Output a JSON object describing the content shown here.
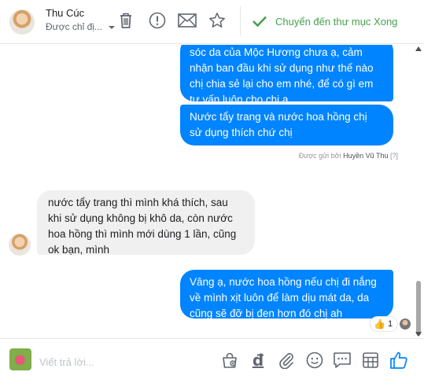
{
  "header": {
    "user_name": "Thu Cúc",
    "assignee_placeholder": "Được chỉ đị...",
    "move_done_label": "Chuyển đến thư mục Xong",
    "icons": [
      "trash-icon",
      "alert-icon",
      "mail-icon",
      "star-icon",
      "checkmark-icon"
    ],
    "accent_color": "#44a24a"
  },
  "messages": [
    {
      "direction": "outgoing",
      "lines": [
        "sóc da của Mộc Hương chưa ạ, cảm",
        "nhận ban đầu khi sử dụng như thế nào",
        "chị chia sẻ lại cho em nhé, để có gì em",
        "tư vấn luôn cho chị ạ"
      ]
    },
    {
      "direction": "outgoing",
      "lines": [
        "Nước tẩy trang và nước hoa hồng chị",
        "sử dụng thích chứ chị"
      ]
    },
    {
      "direction": "incoming",
      "lines": [
        "nước tẩy trang thì mình khá thích, sau",
        "khi sử dụng không bị khô da, còn nước",
        "hoa hồng thì mình mới dùng 1 lần, cũng",
        "ok bạn, mình"
      ]
    },
    {
      "direction": "outgoing",
      "lines": [
        "Vâng ạ, nước hoa hồng nếu chị đi nắng",
        "về mình xịt luôn để làm dịu mát da, da",
        "cũng sẽ đỡ bị đen hơn đó chị ah"
      ]
    }
  ],
  "sent_by": {
    "prefix": "Được gửi bởi",
    "name": "Huyền Vũ Thu",
    "help": "[?]"
  },
  "reaction": {
    "emoji": "👍",
    "count": "1"
  },
  "colors": {
    "outgoing_bubble": "#0084ff",
    "incoming_bubble": "#f1f0f0",
    "like_blue": "#0084ff"
  },
  "composer": {
    "placeholder": "Viết trả lời...",
    "currency_symbol": "đ",
    "icons": [
      "shopping-bag-icon",
      "currency-icon",
      "paperclip-icon",
      "emoji-icon",
      "saved-reply-icon",
      "template-icon",
      "like-icon"
    ]
  }
}
